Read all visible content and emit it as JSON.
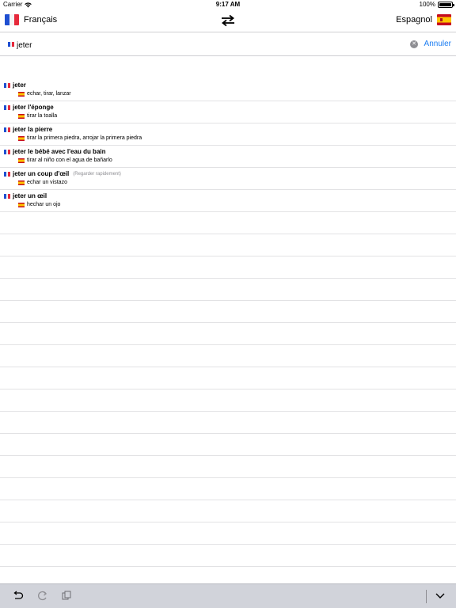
{
  "status": {
    "carrier": "Carrier",
    "time": "9:17 AM",
    "battery": "100%"
  },
  "nav": {
    "source_lang": "Français",
    "target_lang": "Espagnol"
  },
  "search": {
    "value": "jeter",
    "cancel_label": "Annuler"
  },
  "results": [
    {
      "term": "jeter",
      "note": "",
      "translation": "echar, tirar, lanzar"
    },
    {
      "term": "jeter l'éponge",
      "note": "",
      "translation": "tirar la toalla"
    },
    {
      "term": "jeter la pierre",
      "note": "",
      "translation": "tirar la primera piedra, arrojar la primera piedra"
    },
    {
      "term": "jeter le bébé avec l'eau du bain",
      "note": "",
      "translation": "tirar al niño con el agua de bañarlo"
    },
    {
      "term": "jeter un coup d'œil",
      "note": "(Regarder rapidement)",
      "translation": "echar un vistazo"
    },
    {
      "term": "jeter un œil",
      "note": "",
      "translation": "hechar un ojo"
    }
  ],
  "colors": {
    "accent": "#1a7cf2",
    "toolbar": "#d1d3da",
    "fr_blue": "#1f4fd1",
    "fr_red": "#e6293b"
  },
  "icons": {
    "swap": "swap-arrows-icon",
    "undo": "undo-icon",
    "redo": "redo-icon",
    "copy": "copy-icon",
    "collapse": "chevron-down-icon"
  }
}
